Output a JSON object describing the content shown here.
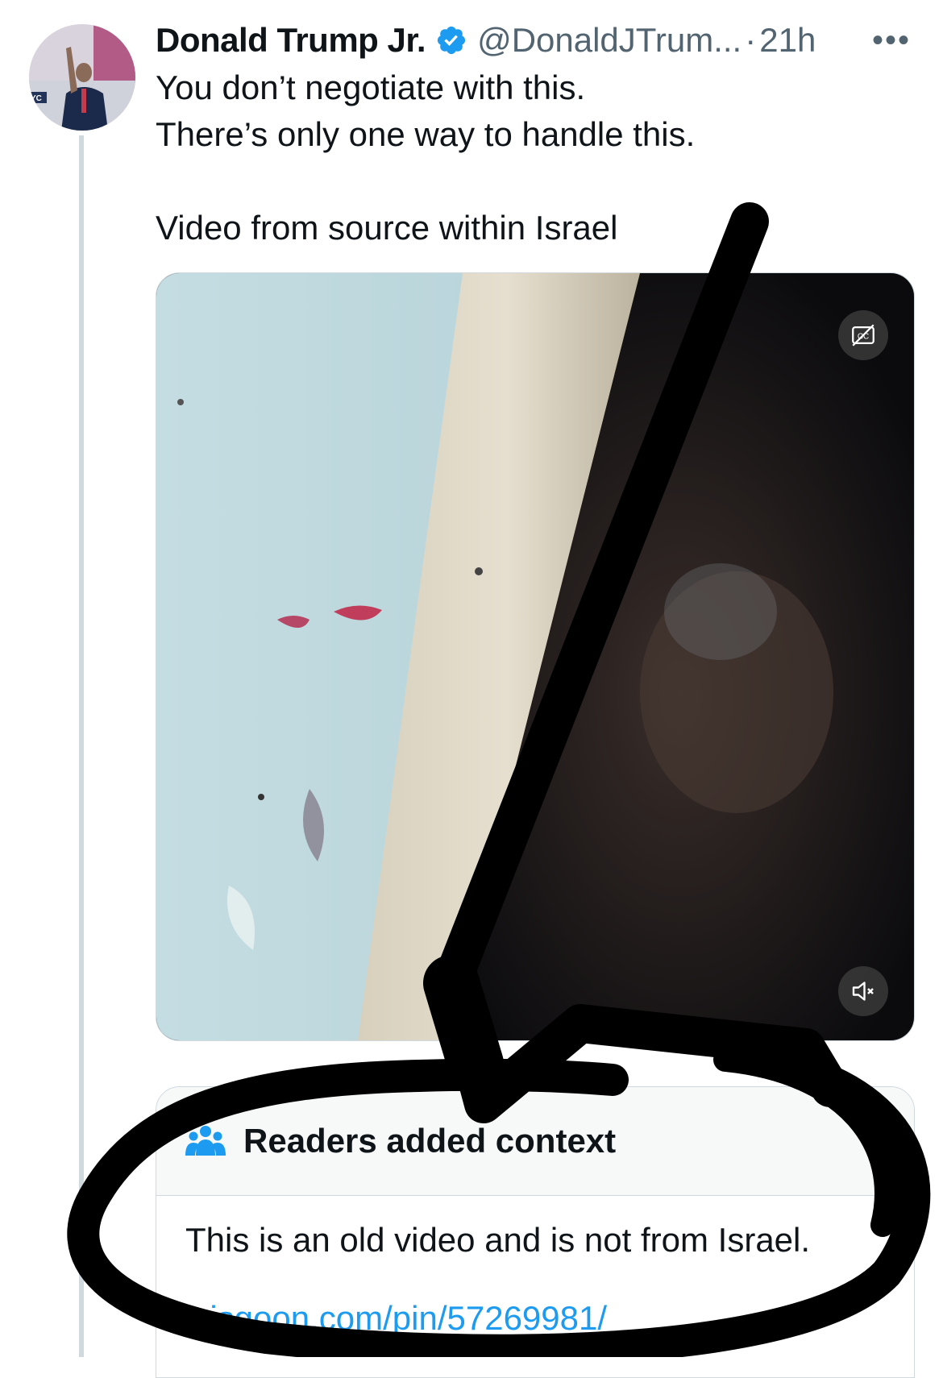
{
  "tweet": {
    "author_name": "Donald Trump Jr.",
    "handle": "@DonaldJTrum...",
    "separator": "·",
    "time": "21h",
    "more_label": "•••",
    "text_line1": "You don’t negotiate with this.",
    "text_line2": "There’s only one way to handle this.",
    "text_line3": "Video from source within Israel",
    "avatar_badge": "YC"
  },
  "video": {
    "captions_icon": "captions-off-icon",
    "mute_icon": "volume-muted-icon"
  },
  "community_note": {
    "title": "Readers added context",
    "body": "This is an old video and is not from Israel.",
    "link": "wisgoon.com/pin/57269981/"
  },
  "colors": {
    "accent": "#1d9bf0",
    "text": "#0f1419",
    "secondary": "#536471",
    "border": "#cfd9de",
    "note_header_bg": "#f7f9f9",
    "marker": "#000000"
  }
}
